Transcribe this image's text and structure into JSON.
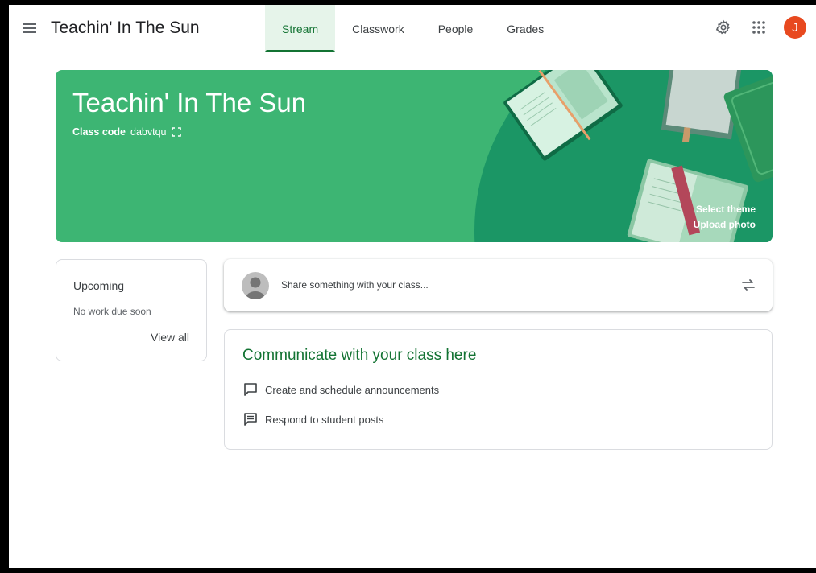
{
  "app": {
    "title": "Teachin' In The Sun"
  },
  "tabs": [
    {
      "label": "Stream",
      "active": true
    },
    {
      "label": "Classwork",
      "active": false
    },
    {
      "label": "People",
      "active": false
    },
    {
      "label": "Grades",
      "active": false
    }
  ],
  "header_icons": {
    "settings": "gear-icon",
    "apps": "apps-grid-icon",
    "account_initial": "J",
    "account_color": "#e8491f"
  },
  "banner": {
    "title": "Teachin' In The Sun",
    "class_code_label": "Class code",
    "class_code": "dabvtqu",
    "select_theme": "Select theme",
    "upload_photo": "Upload photo",
    "color": "#3db573"
  },
  "upcoming": {
    "title": "Upcoming",
    "status": "No work due soon",
    "view_all": "View all"
  },
  "share": {
    "placeholder": "Share something with your class..."
  },
  "communicate": {
    "title": "Communicate with your class here",
    "items": [
      {
        "label": "Create and schedule announcements",
        "icon": "announcement-icon"
      },
      {
        "label": "Respond to student posts",
        "icon": "student-post-icon"
      }
    ]
  },
  "colors": {
    "accent": "#137333",
    "tab_active_bg": "#e6f4ea"
  }
}
